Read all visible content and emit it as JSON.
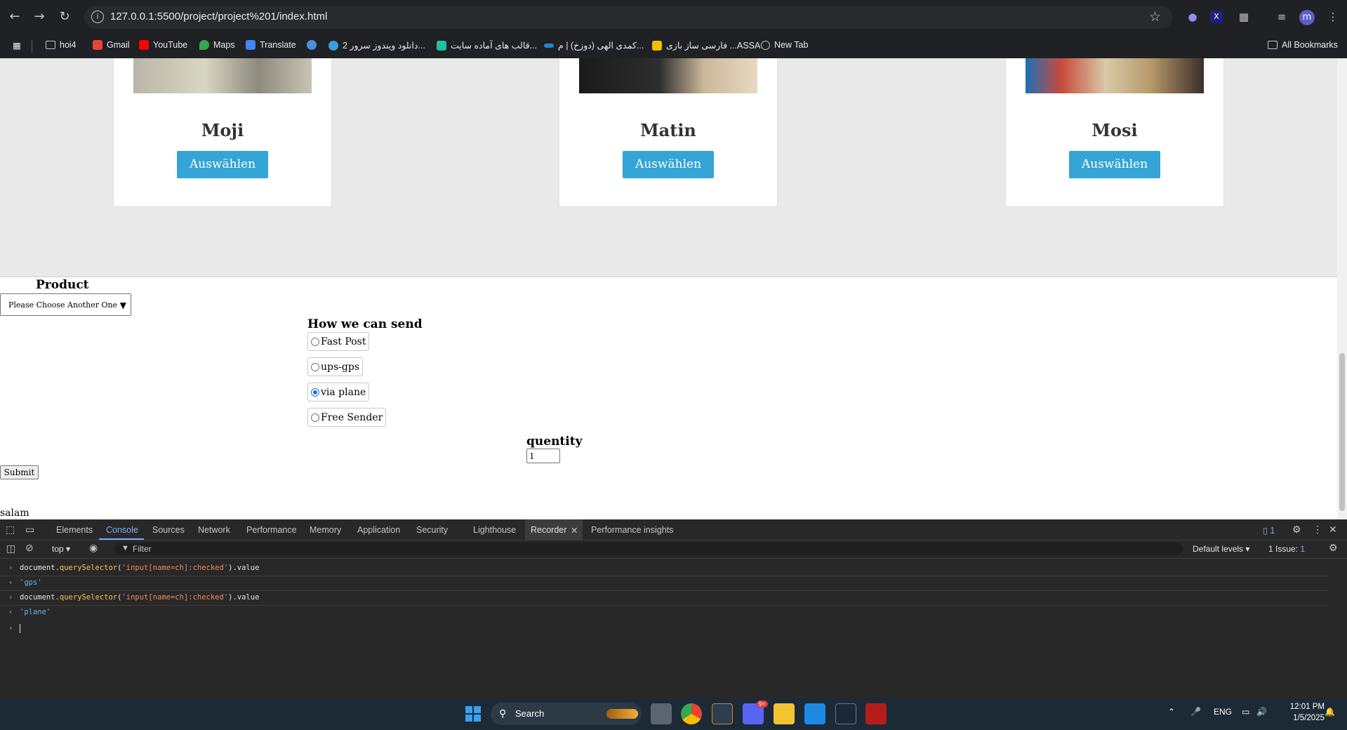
{
  "browser": {
    "url": "127.0.0.1:5500/project/project%201/index.html",
    "bookmarks": [
      {
        "label": "hoi4",
        "icon": "folder-icon"
      },
      {
        "label": "Gmail",
        "icon": "gmail-icon"
      },
      {
        "label": "YouTube",
        "icon": "youtube-icon"
      },
      {
        "label": "Maps",
        "icon": "maps-icon"
      },
      {
        "label": "Translate",
        "icon": "translate-icon"
      },
      {
        "label": "",
        "icon": "bookmark-site-icon"
      },
      {
        "label": "دانلود ویندوز سرور 2...",
        "icon": "bookmark-site-icon"
      },
      {
        "label": "قالب های آماده سایت...",
        "icon": "bookmark-site-icon"
      },
      {
        "label": "کمدی الهی (دوزخ) | م...",
        "icon": "bookmark-site-icon"
      },
      {
        "label": "فارسی ساز بازی ...ASSA",
        "icon": "bookmark-site-icon"
      },
      {
        "label": "New Tab",
        "icon": "globe-icon"
      }
    ],
    "all_bookmarks": "All Bookmarks",
    "avatar_letter": "m"
  },
  "page": {
    "cards": [
      {
        "name": "Moji",
        "button": "Auswählen"
      },
      {
        "name": "Matin",
        "button": "Auswählen"
      },
      {
        "name": "Mosi",
        "button": "Auswählen"
      }
    ],
    "product_label": "Product",
    "product_select": "Please Choose Another One",
    "send_label": "How we can send",
    "send_options": [
      {
        "label": "Fast Post",
        "checked": false
      },
      {
        "label": "ups-gps",
        "checked": false
      },
      {
        "label": "via plane",
        "checked": true
      },
      {
        "label": "Free Sender",
        "checked": false
      }
    ],
    "quantity_label": "quentity",
    "quantity_value": "1",
    "submit": "Submit",
    "footer_text": "salam"
  },
  "devtools": {
    "tabs": [
      "Elements",
      "Console",
      "Sources",
      "Network",
      "Performance",
      "Memory",
      "Application",
      "Security",
      "Lighthouse",
      "Recorder",
      "Performance insights"
    ],
    "active_tab": "Console",
    "issues_badge": "1",
    "context": "top",
    "filter_placeholder": "Filter",
    "levels": "Default levels",
    "issues": "1 Issue:",
    "issues_count": "1",
    "console": [
      {
        "type": "input",
        "parts": [
          "document.",
          "querySelector",
          "(",
          "'input[name=ch]:checked'",
          ").value"
        ]
      },
      {
        "type": "output",
        "text": "'gps'"
      },
      {
        "type": "input",
        "parts": [
          "document.",
          "querySelector",
          "(",
          "'input[name=ch]:checked'",
          ").value"
        ]
      },
      {
        "type": "output",
        "text": "'plane'"
      }
    ]
  },
  "taskbar": {
    "search": "Search",
    "lang": "ENG",
    "time": "12:01 PM",
    "date": "1/5/2025",
    "discord_badge": "9+"
  },
  "colors": {
    "accent_button": "#35a4d6",
    "chrome_bg": "#202124",
    "devtools_bg": "#282828",
    "taskbar_bg": "#1c2a36"
  }
}
